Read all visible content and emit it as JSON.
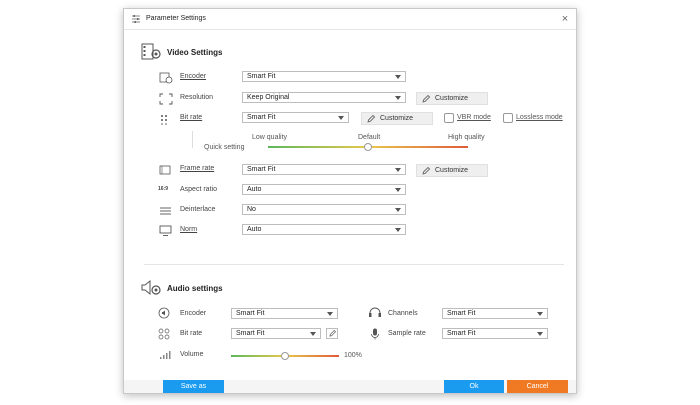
{
  "window": {
    "title": "Parameter Settings"
  },
  "video": {
    "title": "Video Settings",
    "encoder": {
      "label": "Encoder",
      "value": "Smart Fit"
    },
    "resolution": {
      "label": "Resolution",
      "value": "Keep Original",
      "button": "Customize"
    },
    "bitrate": {
      "label": "Bit rate",
      "value": "Smart Fit",
      "button": "Customize",
      "vbr_label": "VBR mode",
      "lossless_label": "Lossless mode",
      "quick_setting": "Quick setting",
      "low": "Low quality",
      "default": "Default",
      "high": "High quality",
      "level": 0.5
    },
    "framerate": {
      "label": "Frame rate",
      "value": "Smart Fit",
      "button": "Customize"
    },
    "aspect": {
      "label": "Aspect ratio",
      "value": "Auto",
      "icon_text": "16:9"
    },
    "deinterlace": {
      "label": "Deinterlace",
      "value": "No"
    },
    "norm": {
      "label": "Norm",
      "value": "Auto"
    }
  },
  "audio": {
    "title": "Audio settings",
    "encoder": {
      "label": "Encoder",
      "value": "Smart Fit"
    },
    "bitrate": {
      "label": "Bit rate",
      "value": "Smart Fit"
    },
    "volume": {
      "label": "Volume",
      "value": "100%",
      "level": 0.5
    },
    "channels": {
      "label": "Channels",
      "value": "Smart Fit"
    },
    "samplerate": {
      "label": "Sample rate",
      "value": "Smart Fit"
    }
  },
  "footer": {
    "save_as": "Save as",
    "ok": "Ok",
    "cancel": "Cancel"
  },
  "colors": {
    "primary": "#1a9bf0",
    "cancel": "#f07a24"
  }
}
